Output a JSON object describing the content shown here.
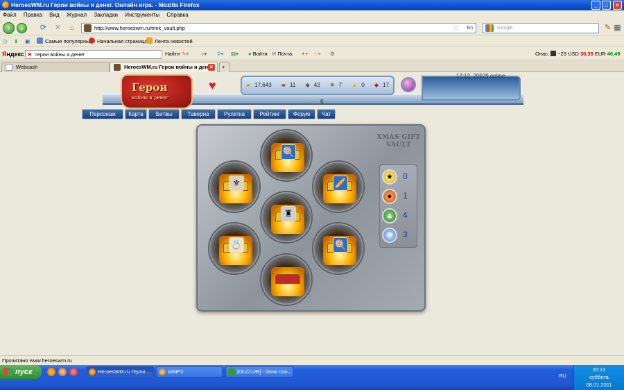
{
  "window": {
    "title": "HeroesWM.ru Герои войны и денег. Онлайн игра. - Mozilla Firefox"
  },
  "menu": [
    "Файл",
    "Правка",
    "Вид",
    "Журнал",
    "Закладки",
    "Инструменты",
    "Справка"
  ],
  "nav": {
    "url": "http://www.heroeswm.ru/trink_vault.php",
    "lang": "En",
    "search_placeholder": "Google"
  },
  "bookmarks": [
    "Самые популярные",
    "Начальная страница",
    "Лента новостей"
  ],
  "yandex": {
    "logo_ya": "Я",
    "logo_rest": "ндекс",
    "query": "герои войны и денег",
    "find": "Найти",
    "weather": "Онас: ",
    "temp": "−29",
    "usd_label": "USD",
    "usd": "30,35",
    "eur_label": "EUR",
    "eur": "40,49",
    "entrance": "Войти",
    "mail": "Почта"
  },
  "tabs": [
    {
      "label": "Webcash",
      "active": false
    },
    {
      "label": "HeroesWM.ru Герои войны и ден...",
      "active": true
    }
  ],
  "game": {
    "online": "17:12, 20979 online",
    "logo_title": "Герои",
    "logo_sub": "войны и денег",
    "resources": [
      "17,643",
      "11",
      "42",
      "7",
      "0",
      "17",
      "6"
    ],
    "nav": [
      "Персонаж",
      "Карта",
      "Битвы",
      "Таверна",
      "Рулетка",
      "Рейтинг",
      "Форум",
      "Чат"
    ],
    "vault_title": "XMAS GIFT VAULT",
    "side_counts": [
      "0",
      "1",
      "4",
      "3"
    ]
  },
  "status": "Прочитано www.heroeswm.ru",
  "taskbar": {
    "start": "пуск",
    "tasks": [
      "HeroesWM.ru Герои ...",
      "AIMP2",
      "[OLCLUB] - Окно соо..."
    ],
    "lang": "RU",
    "time": "20:12",
    "day": "суббота",
    "date": "08.01.2011"
  }
}
